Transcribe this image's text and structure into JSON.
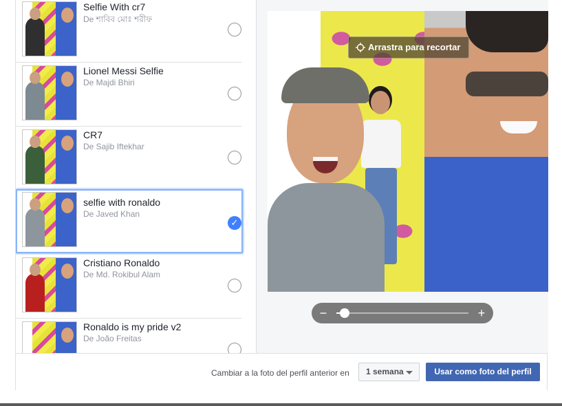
{
  "frames": [
    {
      "title": "Selfie With cr7",
      "author": "De শাবিব মোঃ শরীফ",
      "selected": false
    },
    {
      "title": "Lionel Messi Selfie",
      "author": "De Majdi Bhiri",
      "selected": false
    },
    {
      "title": "CR7",
      "author": "De Sajib Iftekhar",
      "selected": false
    },
    {
      "title": "selfie with ronaldo",
      "author": "De Javed Khan",
      "selected": true
    },
    {
      "title": "Cristiano Ronaldo",
      "author": "De Md. Rokibul Alam",
      "selected": false
    },
    {
      "title": "Ronaldo is my pride v2",
      "author": "De João Freitas",
      "selected": false
    }
  ],
  "preview": {
    "drag_label": "Arrastra para recortar",
    "zoom_minus_symbol": "−",
    "zoom_plus_symbol": "+",
    "zoom_level": 0.06
  },
  "footer": {
    "revert_label": "Cambiar a la foto del perfil anterior en",
    "duration_value": "1 semana",
    "use_button_label": "Usar como foto del perfil"
  },
  "icons": {
    "move": "move-icon",
    "check": "check-icon",
    "chevron": "chevron-down-icon"
  },
  "colors": {
    "primary_button": "#4267b2",
    "selected_check": "#4080ff",
    "selected_outline": "#8ab4f8"
  }
}
